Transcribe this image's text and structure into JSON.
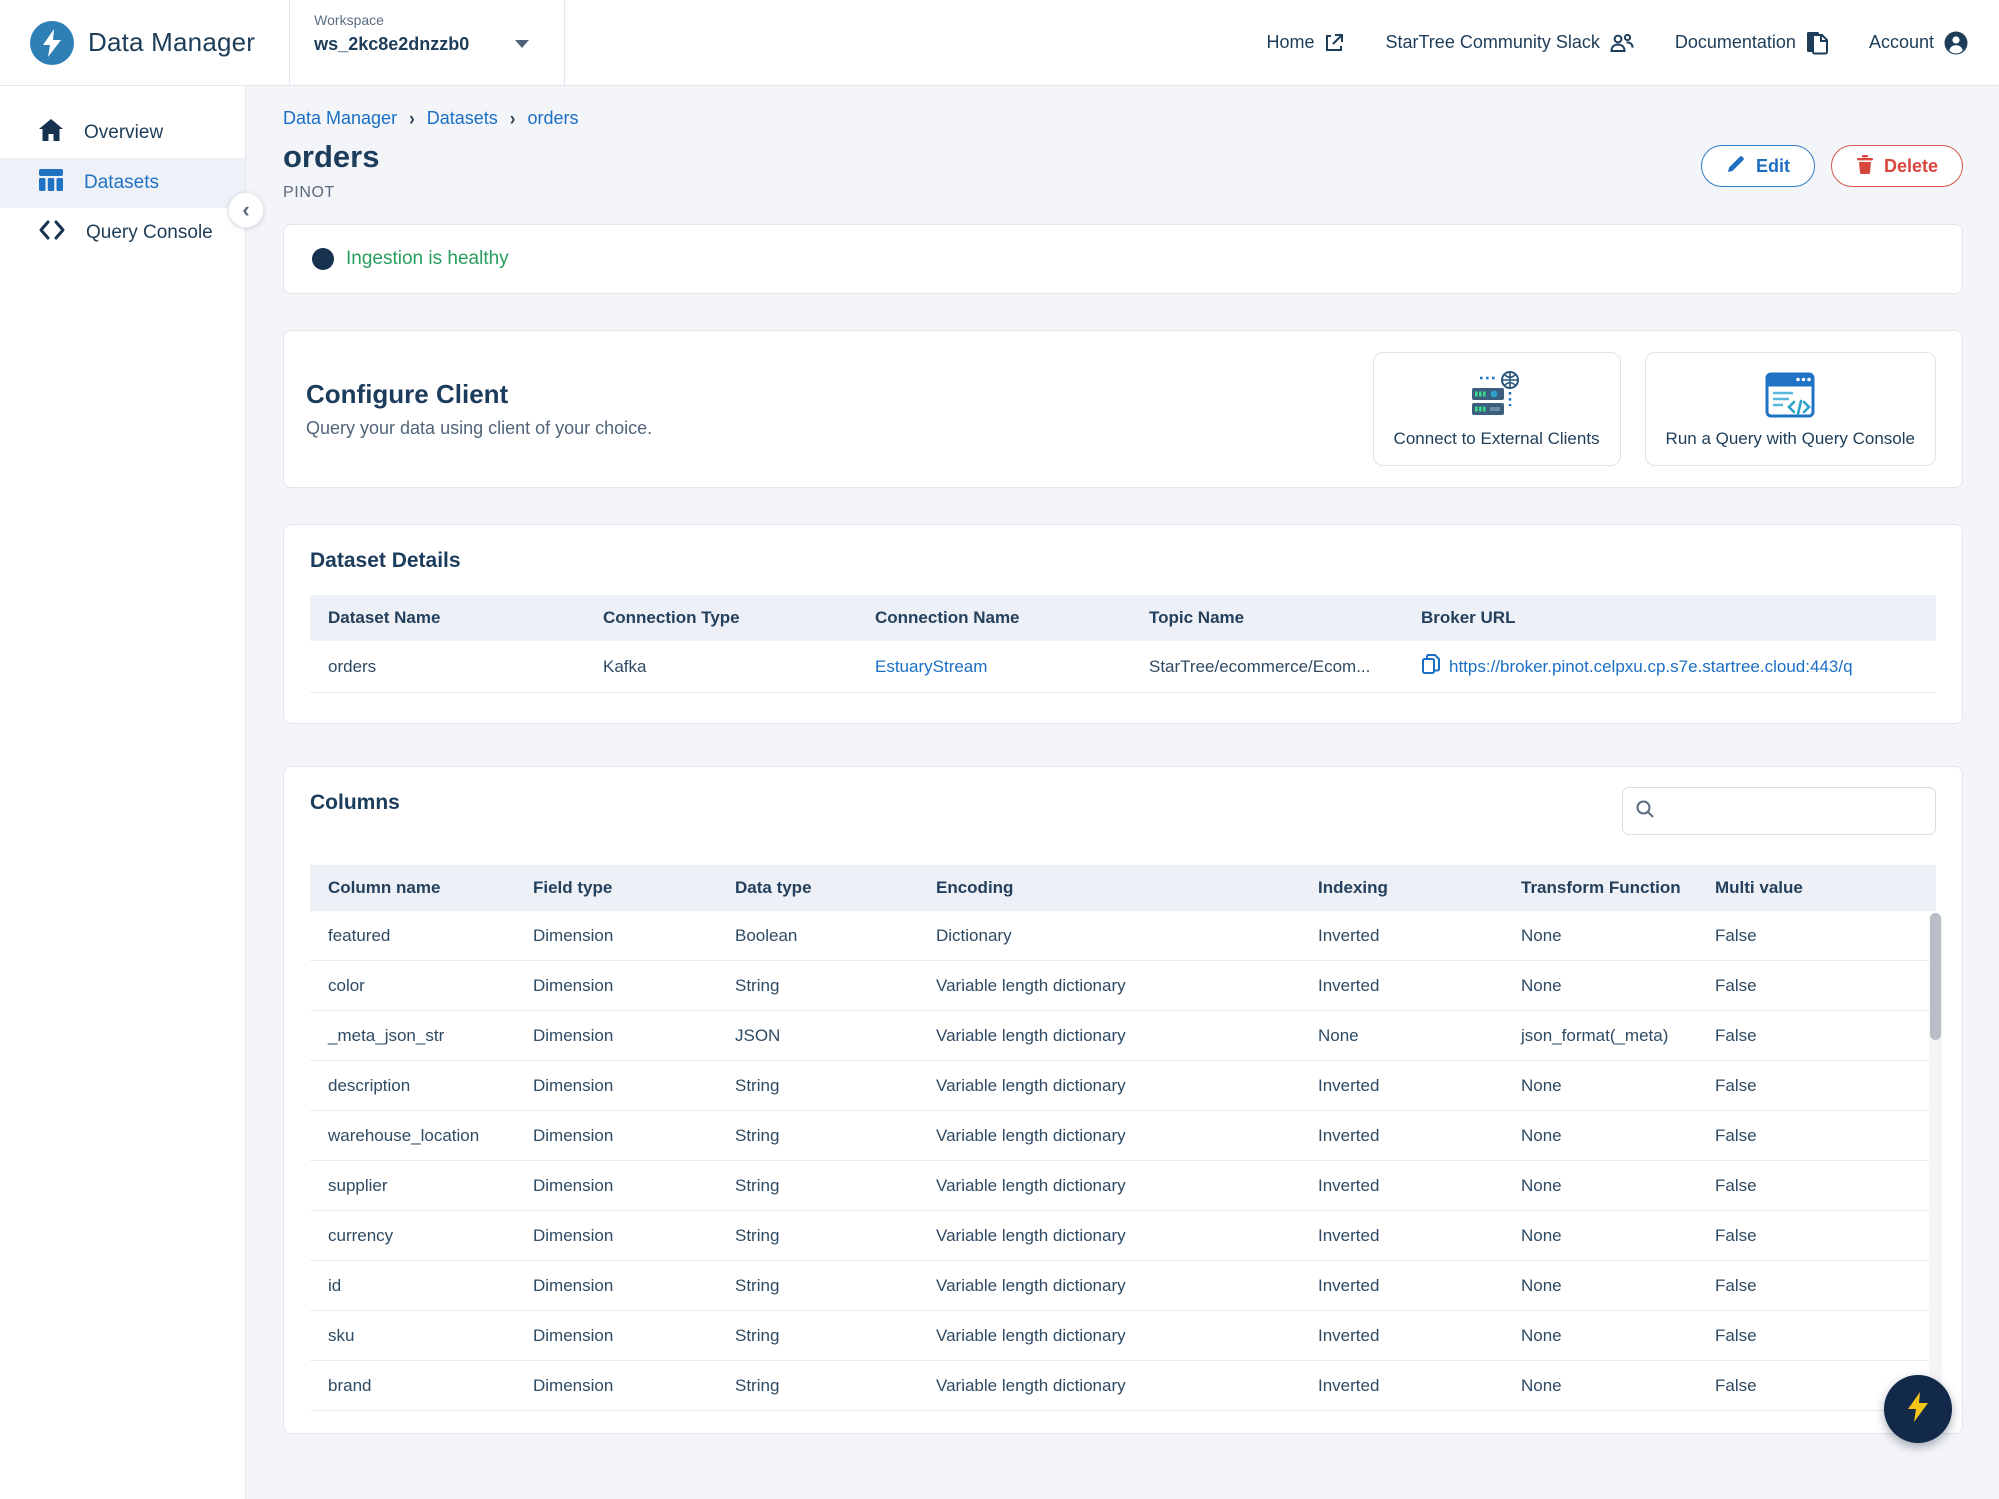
{
  "header": {
    "app_title": "Data Manager",
    "workspace_label": "Workspace",
    "workspace_value": "ws_2kc8e2dnzzb0",
    "nav": [
      {
        "label": "Home",
        "icon": "external-link-icon"
      },
      {
        "label": "StarTree Community Slack",
        "icon": "people-icon"
      },
      {
        "label": "Documentation",
        "icon": "documents-icon"
      },
      {
        "label": "Account",
        "icon": "account-icon"
      }
    ]
  },
  "sidebar": {
    "items": [
      {
        "label": "Overview",
        "icon": "home-icon",
        "active": false
      },
      {
        "label": "Datasets",
        "icon": "datasets-icon",
        "active": true
      },
      {
        "label": "Query Console",
        "icon": "code-icon",
        "active": false
      }
    ]
  },
  "breadcrumb": {
    "items": [
      "Data Manager",
      "Datasets",
      "orders"
    ],
    "separator": "›"
  },
  "page": {
    "title": "orders",
    "subtitle": "PINOT",
    "edit_label": "Edit",
    "delete_label": "Delete"
  },
  "status_banner": {
    "text": "Ingestion is healthy"
  },
  "configure_client": {
    "title": "Configure Client",
    "subtitle": "Query your data using client of your choice.",
    "cards": [
      {
        "label": "Connect to External Clients",
        "icon": "server-globe-icon"
      },
      {
        "label": "Run a Query with Query Console",
        "icon": "query-console-icon"
      }
    ]
  },
  "dataset_details": {
    "title": "Dataset Details",
    "headers": [
      "Dataset Name",
      "Connection Type",
      "Connection Name",
      "Topic Name",
      "Broker URL"
    ],
    "row": {
      "dataset_name": "orders",
      "connection_type": "Kafka",
      "connection_name": "EstuaryStream",
      "topic_name": "StarTree/ecommerce/Ecom...",
      "broker_url": "https://broker.pinot.celpxu.cp.s7e.startree.cloud:443/q"
    }
  },
  "columns_section": {
    "title": "Columns",
    "headers": [
      "Column name",
      "Field type",
      "Data type",
      "Encoding",
      "Indexing",
      "Transform Function",
      "Multi value"
    ],
    "rows": [
      [
        "featured",
        "Dimension",
        "Boolean",
        "Dictionary",
        "Inverted",
        "None",
        "False"
      ],
      [
        "color",
        "Dimension",
        "String",
        "Variable length dictionary",
        "Inverted",
        "None",
        "False"
      ],
      [
        "_meta_json_str",
        "Dimension",
        "JSON",
        "Variable length dictionary",
        "None",
        "json_format(_meta)",
        "False"
      ],
      [
        "description",
        "Dimension",
        "String",
        "Variable length dictionary",
        "Inverted",
        "None",
        "False"
      ],
      [
        "warehouse_location",
        "Dimension",
        "String",
        "Variable length dictionary",
        "Inverted",
        "None",
        "False"
      ],
      [
        "supplier",
        "Dimension",
        "String",
        "Variable length dictionary",
        "Inverted",
        "None",
        "False"
      ],
      [
        "currency",
        "Dimension",
        "String",
        "Variable length dictionary",
        "Inverted",
        "None",
        "False"
      ],
      [
        "id",
        "Dimension",
        "String",
        "Variable length dictionary",
        "Inverted",
        "None",
        "False"
      ],
      [
        "sku",
        "Dimension",
        "String",
        "Variable length dictionary",
        "Inverted",
        "None",
        "False"
      ],
      [
        "brand",
        "Dimension",
        "String",
        "Variable length dictionary",
        "Inverted",
        "None",
        "False"
      ]
    ]
  },
  "colors": {
    "accent_blue": "#1a6fc4",
    "navy": "#1c3c5c",
    "green_status": "#279e5f",
    "red_delete": "#d8453c",
    "fab_bg": "#12294a",
    "fab_bolt": "#f5c518",
    "page_bg": "#f4f5f9",
    "table_header_bg": "#edf0f7"
  }
}
